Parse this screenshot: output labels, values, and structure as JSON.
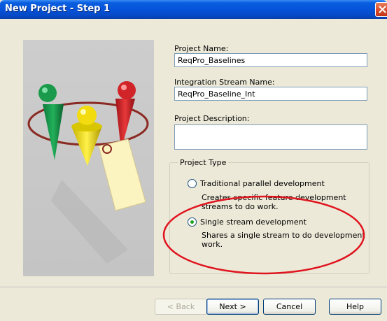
{
  "window": {
    "title": "New Project - Step 1"
  },
  "fields": {
    "project_name_label": "Project Name:",
    "project_name_value": "ReqPro_Baselines",
    "stream_name_label": "Integration Stream Name:",
    "stream_name_value": "ReqPro_Baseline_Int",
    "description_label": "Project Description:",
    "description_value": ""
  },
  "project_type": {
    "legend": "Project Type",
    "options": [
      {
        "label": "Traditional parallel development",
        "description_line1": "Creates specific feature development",
        "description_line2": "streams to do work.",
        "selected": false
      },
      {
        "label": "Single stream development",
        "description_line1": "Shares a single stream to do development",
        "description_line2": "work.",
        "selected": true
      }
    ]
  },
  "buttons": {
    "back": "< Back",
    "next": "Next >",
    "cancel": "Cancel",
    "help": "Help"
  },
  "colors": {
    "annotation_ellipse": "#e0141e",
    "radio_dot": "#21a121",
    "titlebar": "#0652d8"
  }
}
